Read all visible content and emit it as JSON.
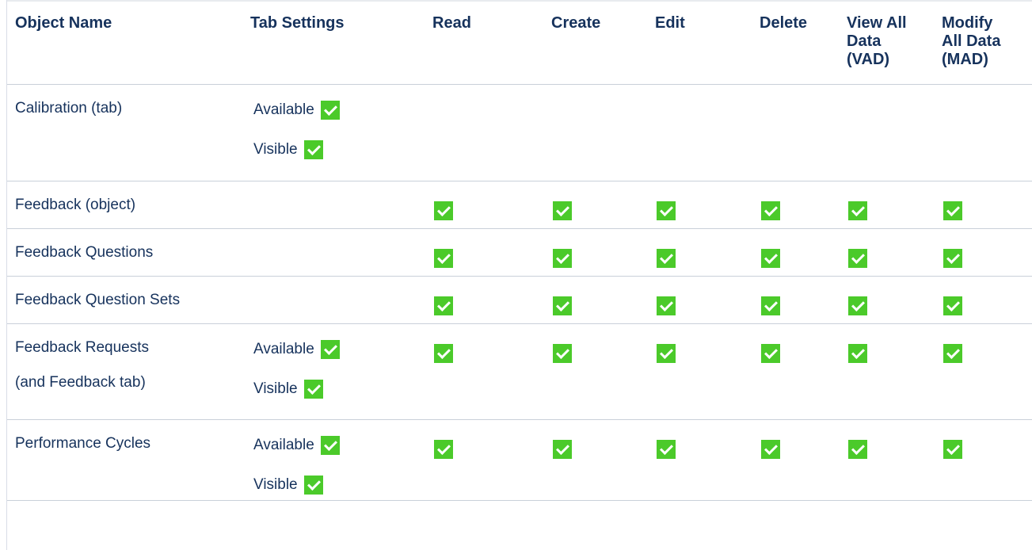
{
  "columns": [
    "Object Name",
    "Tab Settings",
    "Read",
    "Create",
    "Edit",
    "Delete",
    "View All Data (VAD)",
    "Modify All Data (MAD)"
  ],
  "column_lines": [
    [
      "Object Name"
    ],
    [
      "Tab Settings"
    ],
    [
      "Read"
    ],
    [
      "Create"
    ],
    [
      "Edit"
    ],
    [
      "Delete"
    ],
    [
      "View All",
      "Data",
      "(VAD)"
    ],
    [
      "Modify",
      "All Data",
      "(MAD)"
    ]
  ],
  "tab_labels": {
    "available": "Available",
    "visible": "Visible"
  },
  "rows": [
    {
      "object_lines": [
        "Calibration (tab)"
      ],
      "tab_settings": [
        "Available",
        "Visible"
      ],
      "permissions": {
        "read": false,
        "create": false,
        "edit": false,
        "delete": false,
        "vad": false,
        "mad": false
      }
    },
    {
      "object_lines": [
        "Feedback (object)"
      ],
      "tab_settings": [],
      "permissions": {
        "read": true,
        "create": true,
        "edit": true,
        "delete": true,
        "vad": true,
        "mad": true
      }
    },
    {
      "object_lines": [
        "Feedback Questions"
      ],
      "tab_settings": [],
      "permissions": {
        "read": true,
        "create": true,
        "edit": true,
        "delete": true,
        "vad": true,
        "mad": true
      }
    },
    {
      "object_lines": [
        "Feedback Question Sets"
      ],
      "tab_settings": [],
      "permissions": {
        "read": true,
        "create": true,
        "edit": true,
        "delete": true,
        "vad": true,
        "mad": true
      }
    },
    {
      "object_lines": [
        "Feedback Requests",
        "(and Feedback tab)"
      ],
      "tab_settings": [
        "Available",
        "Visible"
      ],
      "permissions": {
        "read": true,
        "create": true,
        "edit": true,
        "delete": true,
        "vad": true,
        "mad": true
      }
    },
    {
      "object_lines": [
        "Performance Cycles"
      ],
      "tab_settings": [
        "Available",
        "Visible"
      ],
      "permissions": {
        "read": true,
        "create": true,
        "edit": true,
        "delete": true,
        "vad": true,
        "mad": true
      }
    }
  ],
  "colors": {
    "check": "#4bca2a",
    "text": "#16325c",
    "border": "#c9d0d9"
  }
}
